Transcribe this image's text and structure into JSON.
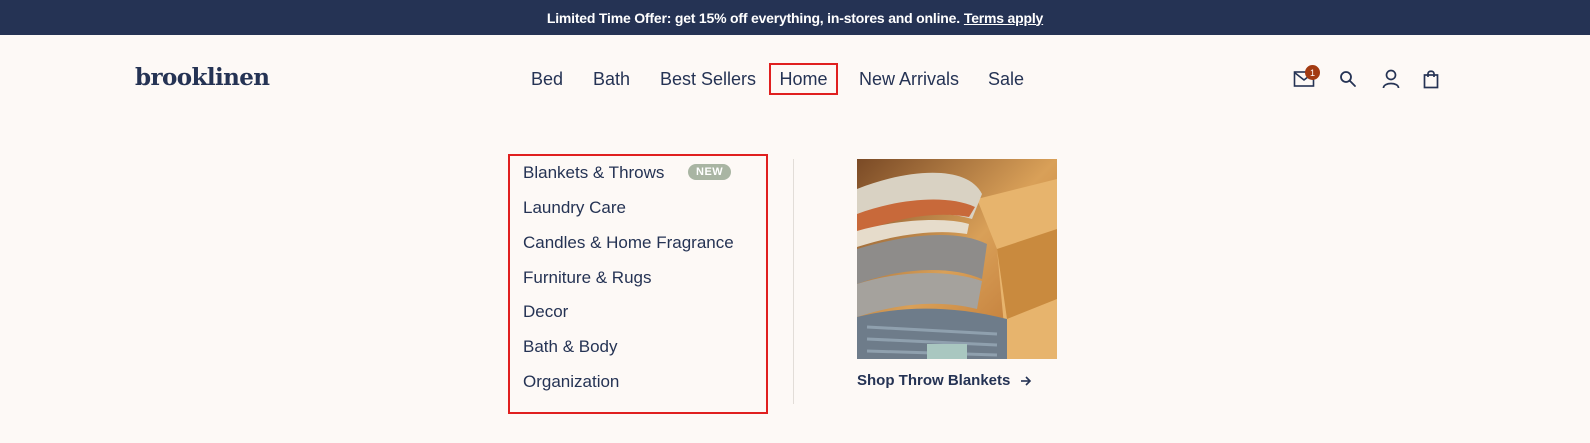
{
  "promo": {
    "text": "Limited Time Offer: get 15% off everything, in-stores and online.",
    "link": "Terms apply"
  },
  "brand": {
    "logo": "brooklinen"
  },
  "nav": {
    "bed": "Bed",
    "bath": "Bath",
    "best_sellers": "Best Sellers",
    "home": "Home",
    "new_arrivals": "New Arrivals",
    "sale": "Sale"
  },
  "utility": {
    "mail_badge": "1",
    "icons": [
      "mail-icon",
      "search-icon",
      "account-icon",
      "cart-icon"
    ]
  },
  "home_menu": {
    "items": [
      {
        "label": "Blankets & Throws",
        "badge": "NEW"
      },
      {
        "label": "Laundry Care"
      },
      {
        "label": "Candles & Home Fragrance"
      },
      {
        "label": "Furniture & Rugs"
      },
      {
        "label": "Decor"
      },
      {
        "label": "Bath & Body"
      },
      {
        "label": "Organization"
      }
    ]
  },
  "feature": {
    "link_label": "Shop Throw Blankets",
    "arrow_icon": "arrow-right-icon"
  },
  "colors": {
    "navy": "#253354",
    "background": "#fdf9f6",
    "badge_rust": "#a33b12",
    "new_badge": "#a9b5a3",
    "highlight": "#e0201f"
  }
}
